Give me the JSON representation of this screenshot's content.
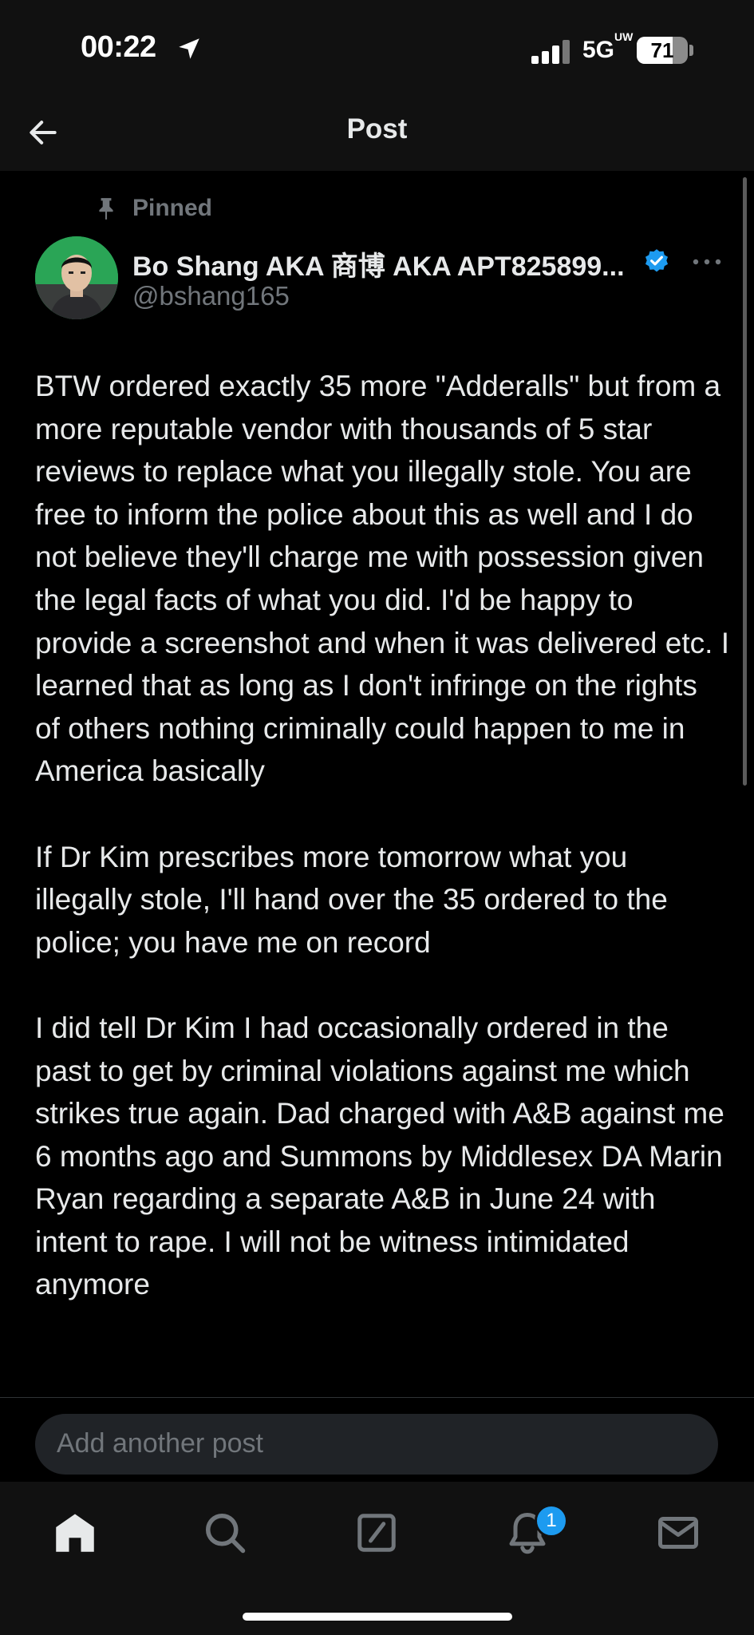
{
  "status_bar": {
    "time": "00:22",
    "network": "5G",
    "network_suffix": "UW",
    "battery": "71",
    "battery_level": 0.71
  },
  "header": {
    "title": "Post"
  },
  "post": {
    "pinned_label": "Pinned",
    "author_name": "Bo Shang AKA 商博 AKA APT825899...",
    "author_handle": "@bshang165",
    "paragraphs": [
      "BTW ordered exactly 35 more \"Adderalls\" but from a more reputable vendor with thousands of 5 star reviews to replace what you illegally stole. You are free to inform the police about this as well and I do not believe they'll charge me with possession given the legal facts of what you did. I'd be happy to provide a screenshot and when it was delivered etc. I learned that as long as I don't infringe on the rights of others nothing criminally could happen to me in America basically",
      "If Dr Kim prescribes more tomorrow what you illegally stole, I'll hand over the 35 ordered to the police; you have me on record",
      "I did tell Dr Kim I had occasionally ordered in the past to get by criminal violations against me which strikes true again. Dad charged with A&B against me 6 months ago and Summons by Middlesex DA Marin Ryan regarding a separate A&B in June 24 with intent to rape. I will not be witness intimidated anymore"
    ]
  },
  "reply": {
    "placeholder": "Add another post"
  },
  "tabbar": {
    "notifications_badge": "1"
  },
  "colors": {
    "background": "#000000",
    "accent": "#1d9bf0",
    "muted_text": "#71767b"
  }
}
